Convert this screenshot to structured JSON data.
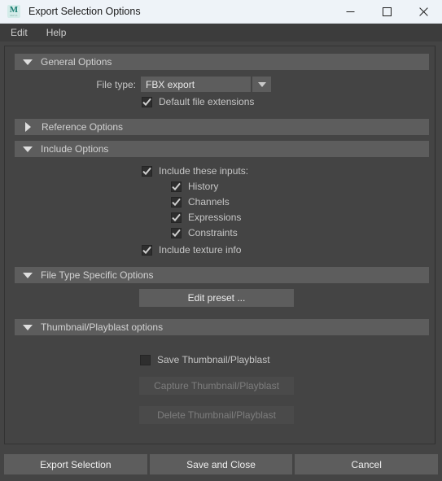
{
  "window": {
    "title": "Export Selection Options",
    "icon": "maya-m-icon",
    "icon_letter": "M",
    "icon_sublabel": "MAYA",
    "minimize_label": "Minimize",
    "maximize_label": "Maximize",
    "close_label": "Close"
  },
  "menubar": {
    "items": [
      {
        "label": "Edit"
      },
      {
        "label": "Help"
      }
    ]
  },
  "sections": {
    "general": {
      "title": "General Options",
      "expanded_icon": "triangle-down-icon",
      "file_type_label": "File type:",
      "file_type_value": "FBX export",
      "dropdown_icon": "chevron-down-icon",
      "default_extensions_label": "Default file extensions",
      "default_extensions_checked": true
    },
    "reference": {
      "title": "Reference Options",
      "collapsed_icon": "triangle-right-icon"
    },
    "include": {
      "title": "Include Options",
      "expanded_icon": "triangle-down-icon",
      "include_inputs_label": "Include these inputs:",
      "include_inputs_checked": true,
      "sub_items": [
        {
          "label": "History",
          "checked": true
        },
        {
          "label": "Channels",
          "checked": true
        },
        {
          "label": "Expressions",
          "checked": true
        },
        {
          "label": "Constraints",
          "checked": true
        }
      ],
      "include_texture_label": "Include texture info",
      "include_texture_checked": true
    },
    "file_type_specific": {
      "title": "File Type Specific Options",
      "expanded_icon": "triangle-down-icon",
      "edit_preset_label": "Edit preset ..."
    },
    "thumbnail": {
      "title": "Thumbnail/Playblast options",
      "expanded_icon": "triangle-down-icon",
      "save_label": "Save Thumbnail/Playblast",
      "save_checked": false,
      "capture_label": "Capture Thumbnail/Playblast",
      "capture_enabled": false,
      "delete_label": "Delete Thumbnail/Playblast",
      "delete_enabled": false
    }
  },
  "footer": {
    "buttons": [
      {
        "label": "Export Selection"
      },
      {
        "label": "Save and Close"
      },
      {
        "label": "Cancel"
      }
    ]
  },
  "colors": {
    "window_background": "#444444",
    "section_header": "#5d5d5d",
    "titlebar_background": "#eef3f8",
    "menubar_background": "#3c3c3c",
    "button_face": "#5d5d5d",
    "text_primary": "#c6c6c6",
    "text_disabled": "#7d7d7d"
  }
}
